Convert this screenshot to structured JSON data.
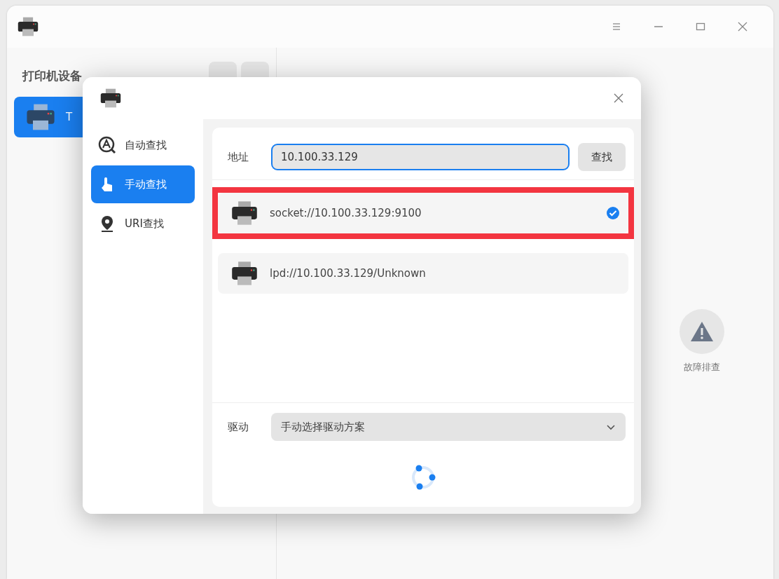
{
  "sidebar": {
    "title": "打印机设备",
    "printers": [
      {
        "label": "T",
        "selected": true
      }
    ]
  },
  "troubleshoot": {
    "label": "故障排查"
  },
  "dialog": {
    "nav": [
      {
        "kind": "auto",
        "label": "自动查找",
        "selected": false
      },
      {
        "kind": "manual",
        "label": "手动查找",
        "selected": true
      },
      {
        "kind": "uri",
        "label": "URI查找",
        "selected": false
      }
    ],
    "address": {
      "label": "地址",
      "value": "10.100.33.129"
    },
    "find_button": "查找",
    "results": [
      {
        "uri": "socket://10.100.33.129:9100",
        "selected": true,
        "highlighted": true
      },
      {
        "uri": "lpd://10.100.33.129/Unknown",
        "selected": false,
        "highlighted": false
      }
    ],
    "driver": {
      "label": "驱动",
      "value": "手动选择驱动方案"
    },
    "loading": true
  }
}
